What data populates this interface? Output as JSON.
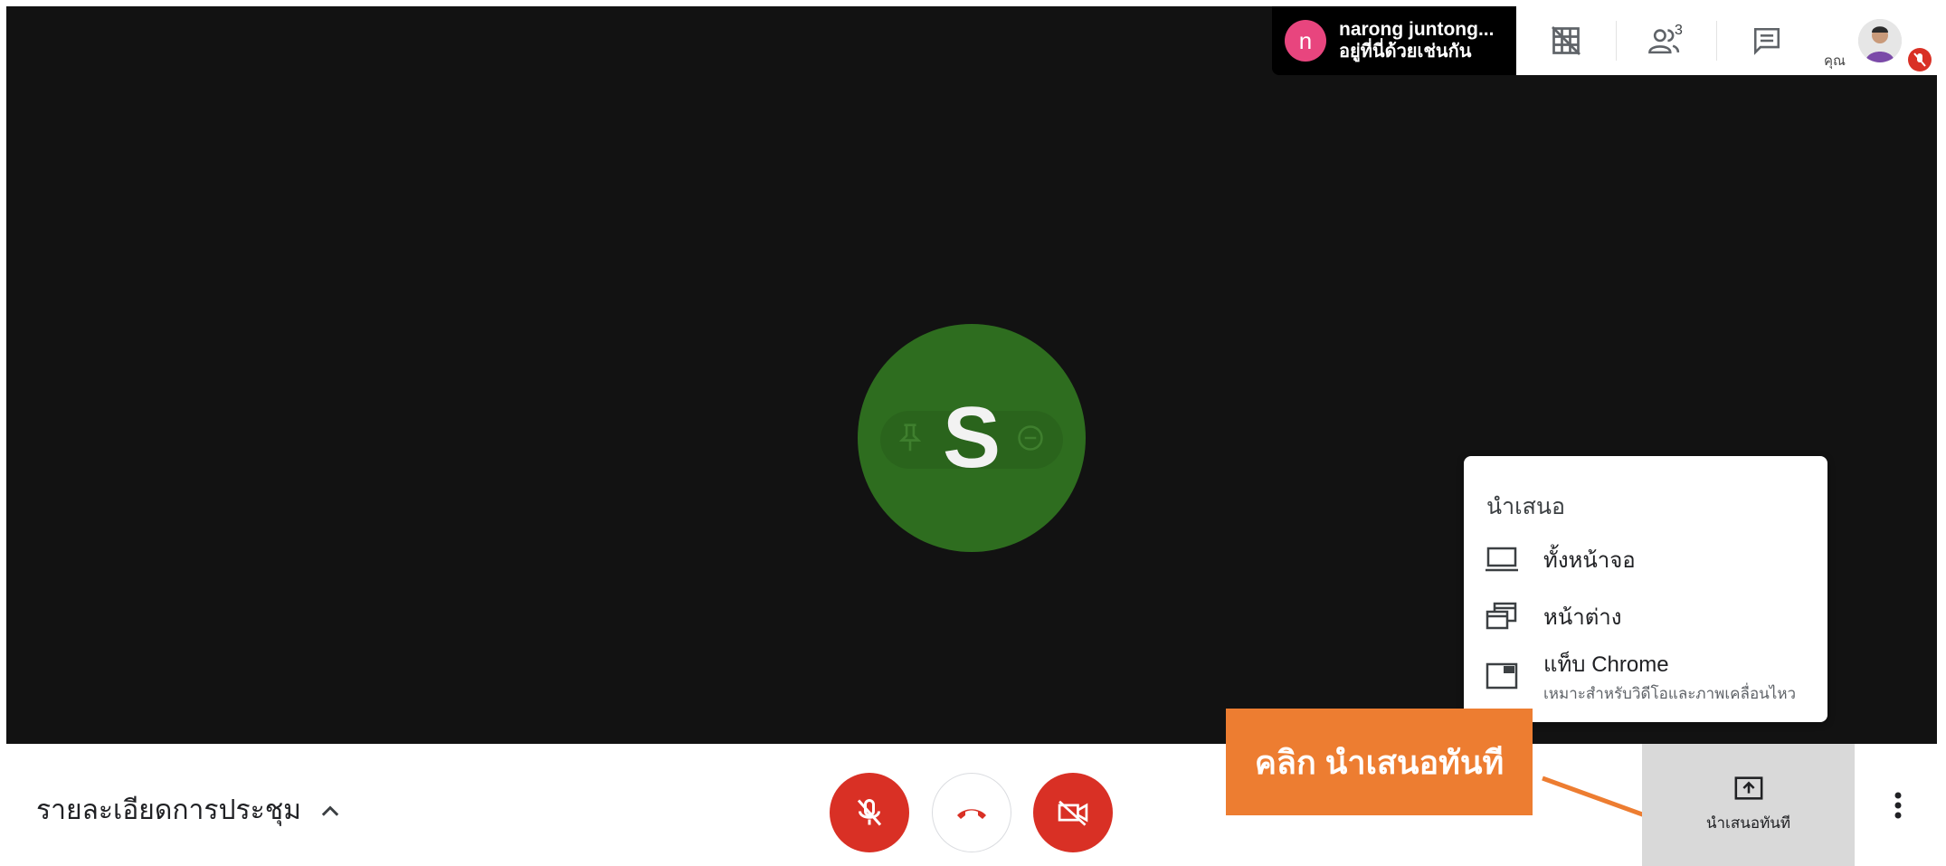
{
  "topbar": {
    "host_initial": "n",
    "host_name": "narong juntong...",
    "host_status": "อยู่ที่นี่ด้วยเช่นกัน",
    "participant_count": "3",
    "self_label": "คุณ"
  },
  "stage": {
    "participant_initial": "S"
  },
  "present_menu": {
    "title": "นำเสนอ",
    "items": [
      {
        "label": "ทั้งหน้าจอ",
        "icon": "monitor-icon"
      },
      {
        "label": "หน้าต่าง",
        "icon": "window-icon"
      },
      {
        "label": "แท็บ Chrome",
        "sub": "เหมาะสำหรับวิดีโอและภาพเคลื่อนไหว",
        "icon": "chrome-tab-icon"
      }
    ]
  },
  "callout": {
    "text": "คลิก นำเสนอทันที"
  },
  "bottom_bar": {
    "details_label": "รายละเอียดการประชุม",
    "present_now_label": "นำเสนอทันที"
  },
  "colors": {
    "danger": "#d93025",
    "callout": "#ed7d31",
    "tile_green": "#2e6d1f",
    "host_avatar": "#e8457e"
  }
}
